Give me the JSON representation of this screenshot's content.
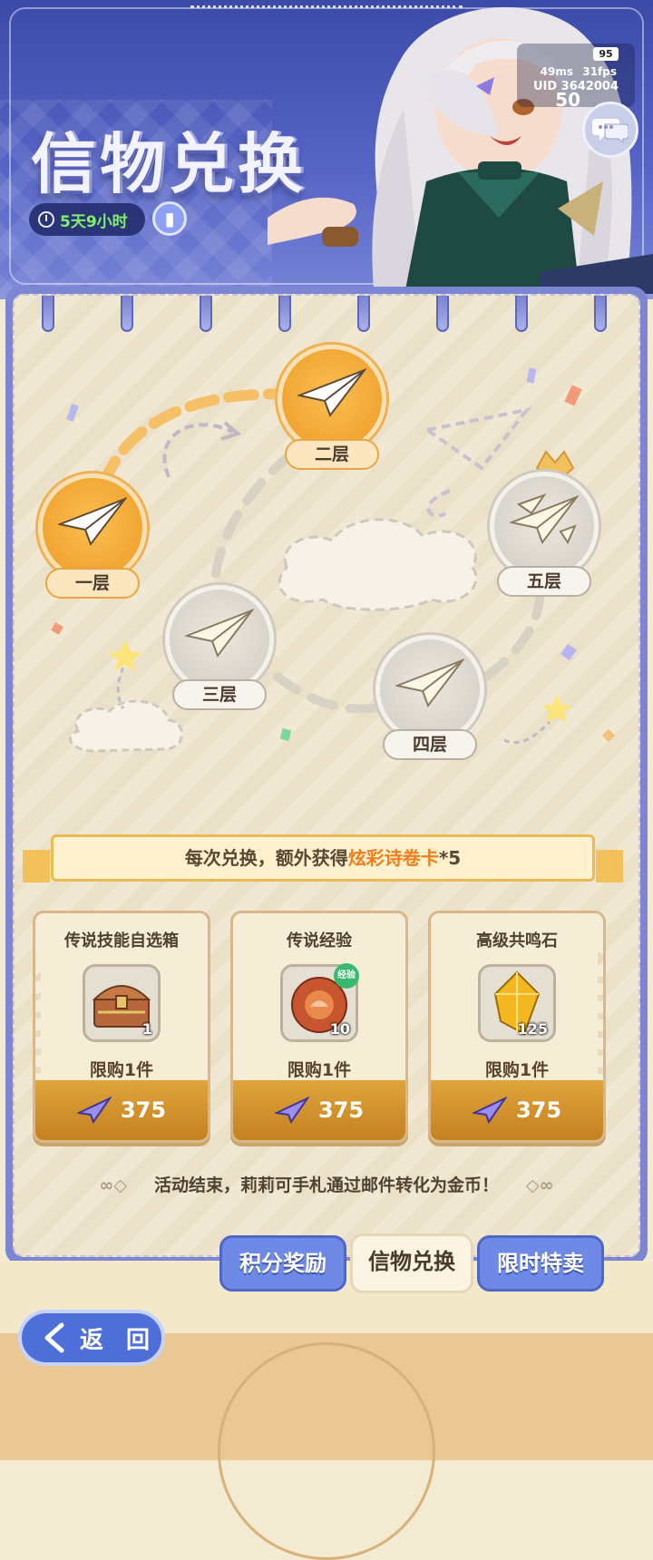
{
  "header": {
    "title": "信物兑换",
    "timer": "5天9小时",
    "status": {
      "battery": "95",
      "ping": "49ms",
      "fps": "31fps",
      "uid": "UID 3642004",
      "count": "50"
    }
  },
  "floors": [
    {
      "label": "一层",
      "state": "unlocked"
    },
    {
      "label": "二层",
      "state": "unlocked"
    },
    {
      "label": "三层",
      "state": "locked"
    },
    {
      "label": "四层",
      "state": "locked"
    },
    {
      "label": "五层",
      "state": "locked"
    }
  ],
  "banner": {
    "prefix": "每次兑换，额外获得",
    "highlight": "炫彩诗卷卡",
    "suffix": "*5"
  },
  "shop_items": [
    {
      "name": "传说技能自选箱",
      "qty": "1",
      "limit": "限购1件",
      "price": "375",
      "icon": "treasure-chest-icon"
    },
    {
      "name": "传说经验",
      "qty": "10",
      "limit": "限购1件",
      "price": "375",
      "icon": "exp-orb-icon",
      "badge": "经验"
    },
    {
      "name": "高级共鸣石",
      "qty": "125",
      "limit": "限购1件",
      "price": "375",
      "icon": "gem-icon"
    }
  ],
  "footnote": "活动结束，莉莉可手札通过邮件转化为金币！",
  "tabs": [
    {
      "label": "积分奖励",
      "active": false
    },
    {
      "label": "信物兑换",
      "active": true
    },
    {
      "label": "限时特卖",
      "active": false
    }
  ],
  "back_label": "返 回",
  "colors": {
    "accent_gold": "#f1a532",
    "header_blue": "#4b59b8",
    "highlight_orange": "#f07c1a"
  }
}
